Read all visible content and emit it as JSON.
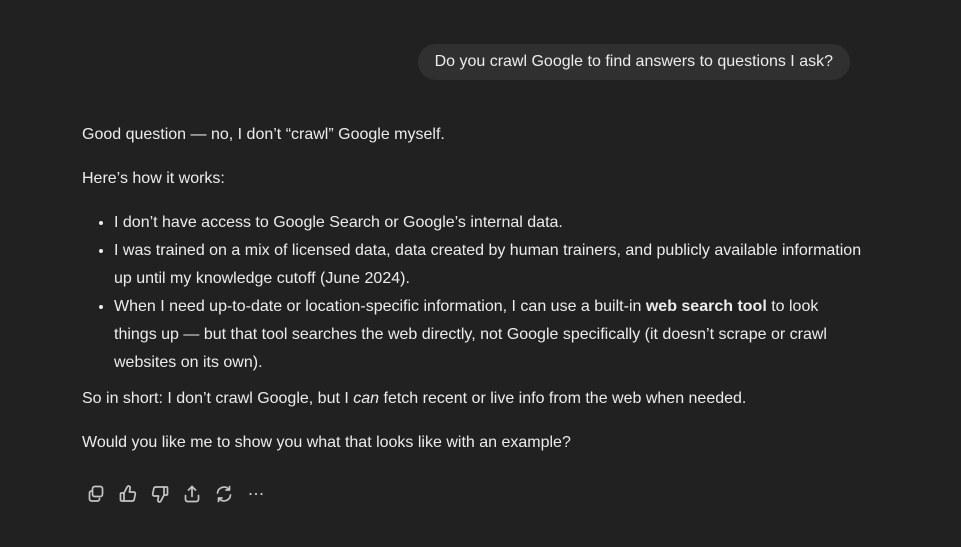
{
  "user_message": "Do you crawl Google to find answers to questions I ask?",
  "assistant": {
    "intro": "Good question — no, I don’t “crawl” Google myself.",
    "how_it_works": "Here’s how it works:",
    "bullets": [
      {
        "text": "I don’t have access to Google Search or Google’s internal data."
      },
      {
        "text": "I was trained on a mix of licensed data, data created by human trainers, and publicly available information up until my knowledge cutoff (June 2024)."
      },
      {
        "before": "When I need up-to-date or location-specific information, I can use a built-in ",
        "bold": "web search tool",
        "after": " to look things up — but that tool searches the web directly, not Google specifically (it doesn’t scrape or crawl websites on its own)."
      }
    ],
    "summary_before": "So in short: I don’t crawl Google, but I ",
    "summary_italic": "can",
    "summary_after": " fetch recent or live info from the web when needed.",
    "followup": "Would you like me to show you what that looks like with an example?"
  },
  "actions": [
    {
      "icon": "copy-icon"
    },
    {
      "icon": "thumbs-up-icon"
    },
    {
      "icon": "thumbs-down-icon"
    },
    {
      "icon": "share-icon"
    },
    {
      "icon": "regenerate-icon"
    },
    {
      "icon": "more-icon"
    }
  ],
  "colors": {
    "background": "#212121",
    "user_bubble": "#303030",
    "text": "#ececec",
    "icon": "#c5c5c5"
  }
}
